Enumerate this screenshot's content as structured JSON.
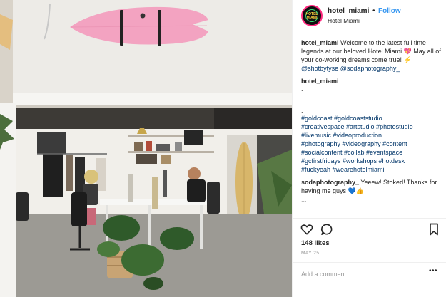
{
  "colors": {
    "accent_link": "#3897f0",
    "mention": "#003569",
    "avatar_ring": "#ff2a7f",
    "surfboard": "#f3a3c1"
  },
  "photo": {
    "alt_icon": "office-photo"
  },
  "header": {
    "username": "hotel_miami",
    "separator": "•",
    "follow_label": "Follow",
    "location": "Hotel Miami",
    "avatar_text": "HOTEL MIAMI"
  },
  "caption": {
    "user": "hotel_miami",
    "text": "Welcome to the latest full time legends at our beloved Hotel Miami 💖 May all of your co-working dreams come true! ⚡",
    "mention1": "@shotbytyse",
    "mention2": "@sodaphotography_"
  },
  "comment1": {
    "user": "hotel_miami",
    "text": ".",
    "dots": [
      ".",
      ".",
      ".",
      "."
    ],
    "hashtags": [
      "#goldcoast #goldcoaststudio",
      "#creativespace #artstudio #photostudio",
      "#livemusic #videoproduction",
      "#photography #videography #content",
      "#socialcontent #collab #eventspace",
      "#gcfirstfridays #workshops #hotdesk",
      "#fuckyeah #wearehotelmiami"
    ]
  },
  "comment2": {
    "user": "sodaphotography_",
    "text": "Yeeew! Stoked! Thanks for having me guys 💙👍",
    "cut_off": "..."
  },
  "actions": {
    "like_icon": "heart-icon",
    "comment_icon": "comment-icon",
    "save_icon": "bookmark-icon"
  },
  "likes": "148 likes",
  "date": "MAY 25",
  "add_comment": {
    "placeholder": "Add a comment...",
    "more_label": "•••"
  }
}
